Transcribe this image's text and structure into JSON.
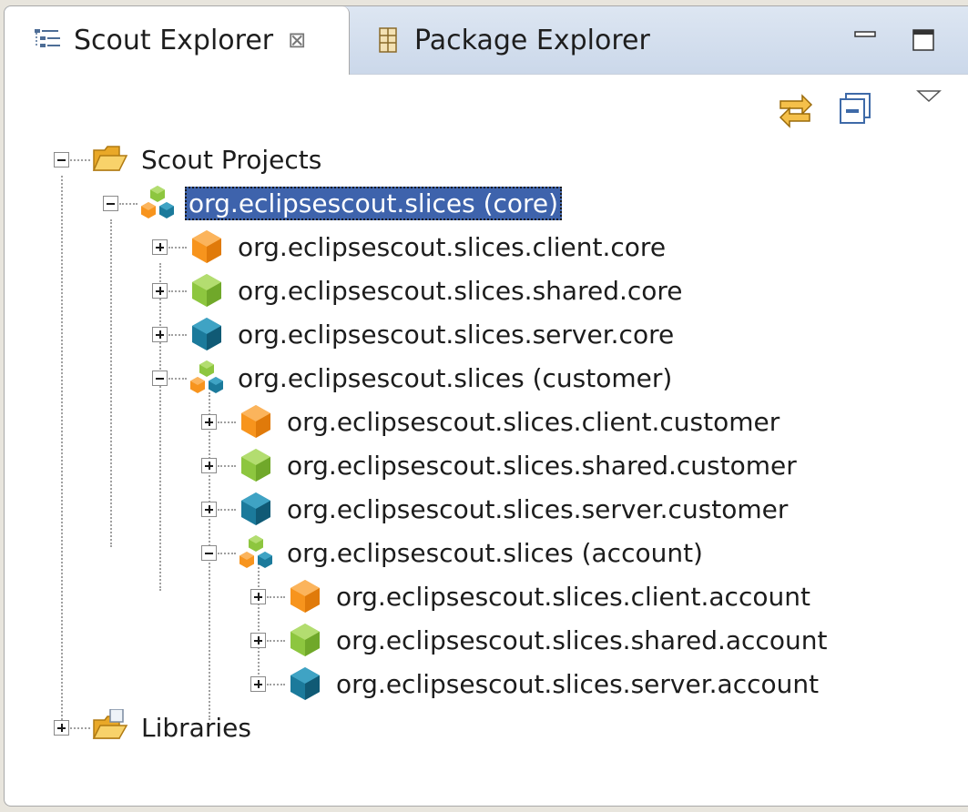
{
  "tabs": {
    "active": {
      "label": "Scout Explorer",
      "close": "⊠"
    },
    "inactive": {
      "label": "Package Explorer"
    }
  },
  "icons": {
    "tab_scout": "tree-view-icon",
    "tab_package": "package-icon",
    "minimize": "minimize-icon",
    "maximize": "maximize-icon",
    "link": "link-with-editor-icon",
    "collapse": "collapse-all-icon",
    "menu": "view-menu-icon"
  },
  "colors": {
    "selection": "#3e63ac",
    "client": "#f7941d",
    "shared": "#8dc63f",
    "server": "#1b7a9b",
    "folder": "#f5c04a"
  },
  "tree": {
    "scout_projects": "Scout Projects",
    "core": "org.eclipsescout.slices (core)",
    "client_core": "org.eclipsescout.slices.client.core",
    "shared_core": "org.eclipsescout.slices.shared.core",
    "server_core": "org.eclipsescout.slices.server.core",
    "customer": "org.eclipsescout.slices (customer)",
    "client_customer": "org.eclipsescout.slices.client.customer",
    "shared_customer": "org.eclipsescout.slices.shared.customer",
    "server_customer": "org.eclipsescout.slices.server.customer",
    "account": "org.eclipsescout.slices (account)",
    "client_account": "org.eclipsescout.slices.client.account",
    "shared_account": "org.eclipsescout.slices.shared.account",
    "server_account": "org.eclipsescout.slices.server.account",
    "libraries": "Libraries"
  }
}
